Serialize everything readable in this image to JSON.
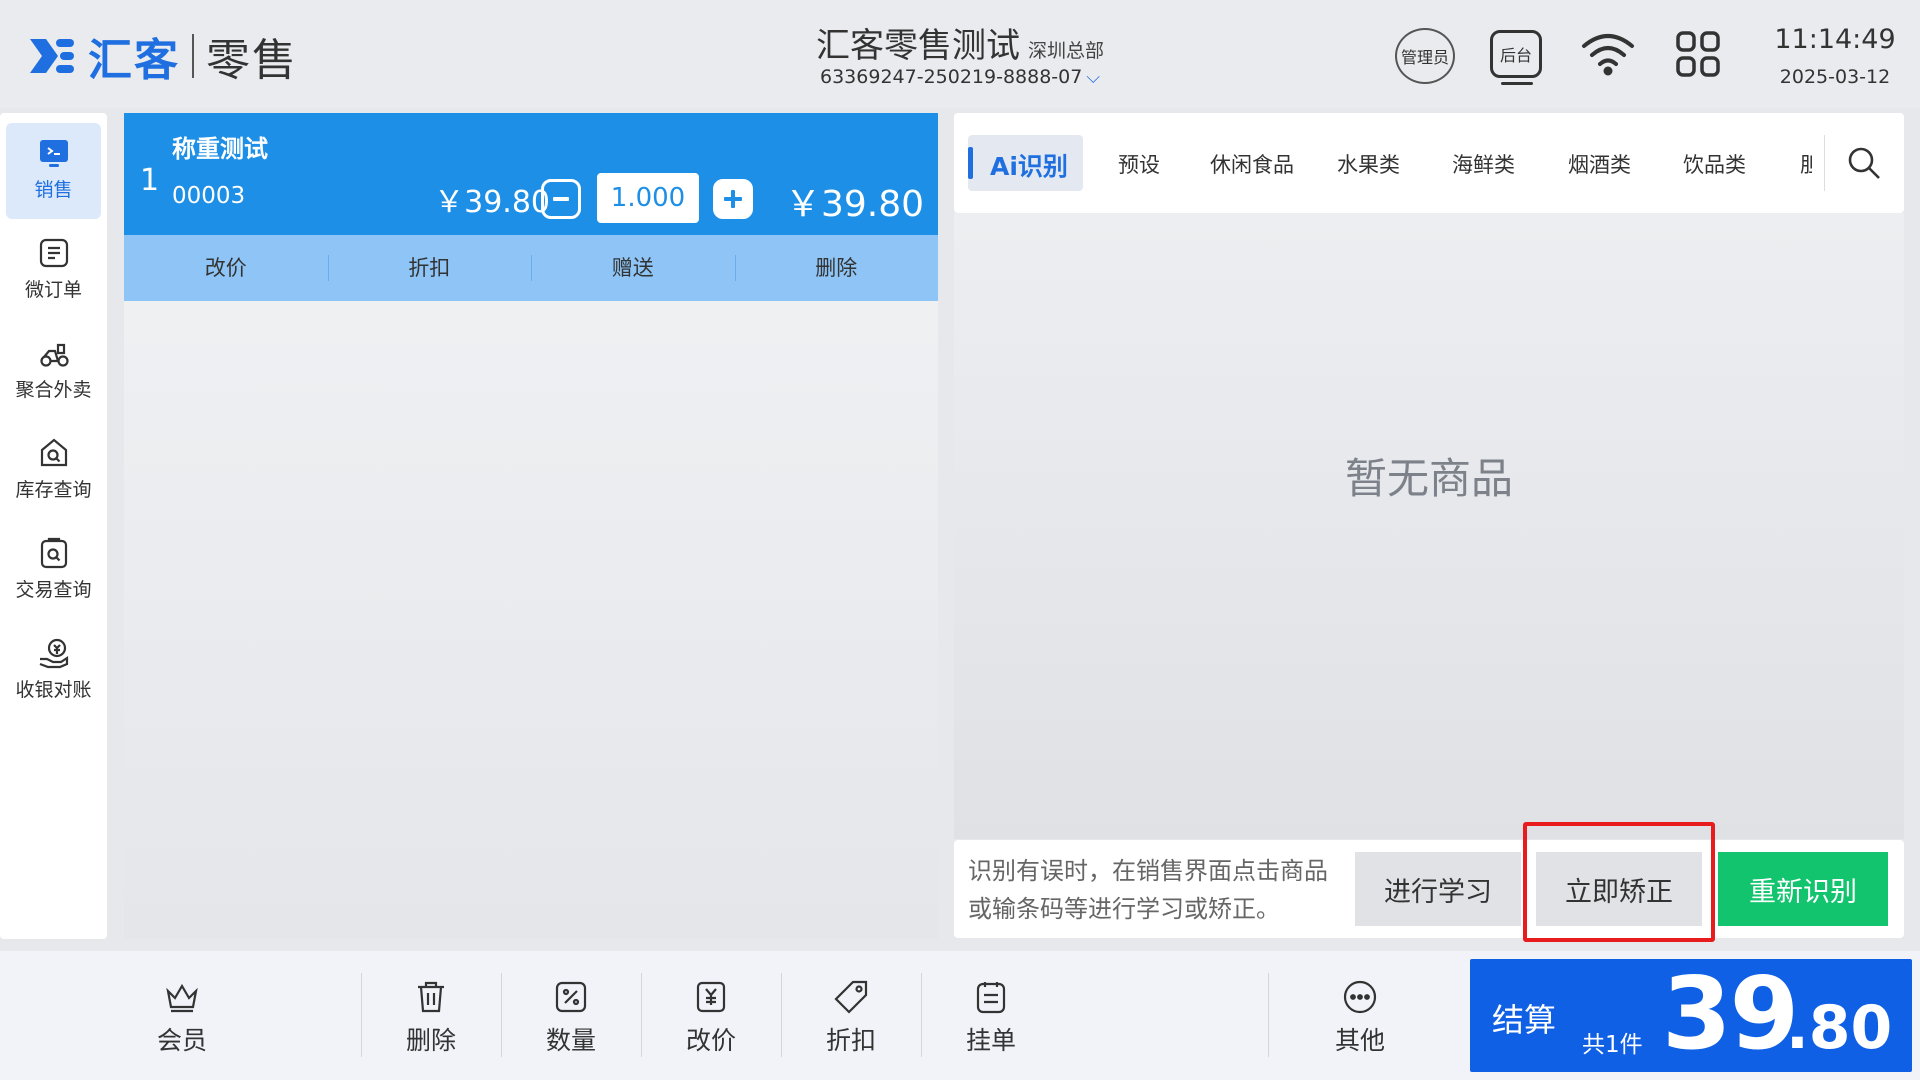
{
  "header": {
    "brand": "汇客",
    "brand_sub": "零售",
    "store_name": "汇客零售测试",
    "store_branch": "深圳总部",
    "device_id": "63369247-250219-8888-07",
    "role_badge": "管理员",
    "backstage_label": "后台",
    "time": "11:14:49",
    "date": "2025-03-12"
  },
  "sidebar": {
    "items": [
      {
        "label": "销售",
        "icon": "monitor-icon",
        "active": true
      },
      {
        "label": "微订单",
        "icon": "order-icon",
        "active": false
      },
      {
        "label": "聚合外卖",
        "icon": "delivery-icon",
        "active": false
      },
      {
        "label": "库存查询",
        "icon": "inventory-icon",
        "active": false
      },
      {
        "label": "交易查询",
        "icon": "transaction-icon",
        "active": false
      },
      {
        "label": "收银对账",
        "icon": "reconcile-icon",
        "active": false
      }
    ]
  },
  "cart": {
    "items": [
      {
        "index": "1",
        "name": "称重测试",
        "code": "00003",
        "unit_price": "￥39.80",
        "quantity": "1.000",
        "total": "￥39.80"
      }
    ],
    "row_actions": [
      "改价",
      "折扣",
      "赠送",
      "删除"
    ]
  },
  "categories": {
    "active": "Ai识别",
    "items": [
      "预设",
      "休闲食品",
      "水果类",
      "海鲜类",
      "烟酒类",
      "饮品类",
      "胆"
    ]
  },
  "products": {
    "empty_text": "暂无商品"
  },
  "ai_bar": {
    "hint": "识别有误时，在销售界面点击商品或输条码等进行学习或矫正。",
    "learn_label": "进行学习",
    "correct_label": "立即矫正",
    "reidentify_label": "重新识别"
  },
  "toolbar": {
    "items": [
      {
        "label": "会员",
        "icon": "crown-icon"
      },
      {
        "label": "删除",
        "icon": "trash-icon"
      },
      {
        "label": "数量",
        "icon": "percent-box-icon"
      },
      {
        "label": "改价",
        "icon": "price-tag-icon"
      },
      {
        "label": "折扣",
        "icon": "discount-tag-icon"
      },
      {
        "label": "挂单",
        "icon": "clipboard-icon"
      },
      {
        "label": "其他",
        "icon": "more-icon"
      }
    ]
  },
  "checkout": {
    "label": "结算",
    "count": "共1件",
    "amount_int": "39",
    "amount_dec": ".80"
  },
  "colors": {
    "accent": "#1f6fe0",
    "cart_row": "#1d8fe6",
    "row_actions": "#8ec5f6",
    "reidentify": "#12c46d",
    "checkout": "#1060e6",
    "highlight": "#e81c1c"
  }
}
